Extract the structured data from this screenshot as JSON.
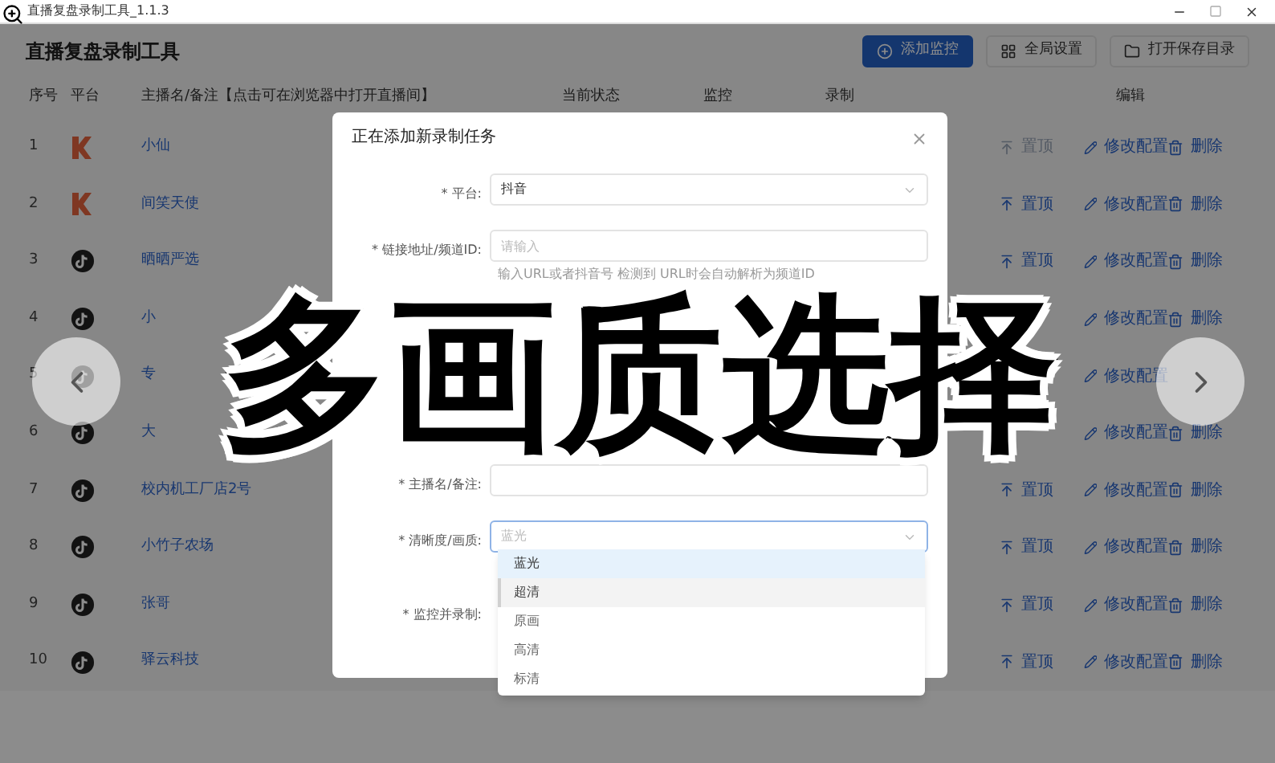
{
  "window": {
    "title": "直播复盘录制工具_1.1.3"
  },
  "header": {
    "title": "直播复盘录制工具",
    "buttons": [
      {
        "label": "添加监控",
        "kind": "primary"
      },
      {
        "label": "全局设置",
        "kind": "settings"
      },
      {
        "label": "打开保存目录",
        "kind": "folder"
      }
    ]
  },
  "table": {
    "columns": [
      "序号",
      "平台",
      "主播名/备注【点击可在浏览器中打开直播间】",
      "当前状态",
      "监控",
      "录制",
      "编辑"
    ],
    "rows": [
      {
        "index": "1",
        "kind": "kuaishou",
        "name": "小仙",
        "actions": [
          {
            "kind": "pin",
            "label": "置顶",
            "disabled": true
          },
          {
            "kind": "edit",
            "label": "修改配置",
            "disabled": false
          },
          {
            "kind": "delete",
            "label": "删除",
            "disabled": false
          }
        ]
      },
      {
        "index": "2",
        "kind": "kuaishou",
        "name": "间笑天使",
        "actions": [
          {
            "kind": "pin",
            "label": "置顶",
            "disabled": false
          },
          {
            "kind": "edit",
            "label": "修改配置",
            "disabled": false
          },
          {
            "kind": "delete",
            "label": "删除",
            "disabled": false
          }
        ]
      },
      {
        "index": "3",
        "kind": "douyin",
        "name": "晒晒严选",
        "actions": [
          {
            "kind": "pin",
            "label": "置顶",
            "disabled": false
          },
          {
            "kind": "edit",
            "label": "修改配置",
            "disabled": false
          },
          {
            "kind": "delete",
            "label": "删除",
            "disabled": false
          }
        ]
      },
      {
        "index": "4",
        "kind": "douyin",
        "name": "小",
        "actions": [
          {
            "kind": "edit",
            "label": "修改配置",
            "disabled": false
          },
          {
            "kind": "delete",
            "label": "删除",
            "disabled": false
          }
        ]
      },
      {
        "index": "5",
        "kind": "douyin",
        "name": "专",
        "actions": [
          {
            "kind": "edit",
            "label": "修改配置",
            "disabled": false
          }
        ]
      },
      {
        "index": "6",
        "kind": "douyin",
        "name": "大",
        "actions": [
          {
            "kind": "edit",
            "label": "修改配置",
            "disabled": false
          },
          {
            "kind": "delete",
            "label": "删除",
            "disabled": false
          }
        ]
      },
      {
        "index": "7",
        "kind": "douyin",
        "name": "校内机工厂店2号",
        "actions": [
          {
            "kind": "pin",
            "label": "置顶",
            "disabled": false
          },
          {
            "kind": "edit",
            "label": "修改配置",
            "disabled": false
          },
          {
            "kind": "delete",
            "label": "删除",
            "disabled": false
          }
        ]
      },
      {
        "index": "8",
        "kind": "douyin",
        "name": "小竹子农场",
        "actions": [
          {
            "kind": "pin",
            "label": "置顶",
            "disabled": false
          },
          {
            "kind": "edit",
            "label": "修改配置",
            "disabled": false
          },
          {
            "kind": "delete",
            "label": "删除",
            "disabled": false
          }
        ]
      },
      {
        "index": "9",
        "kind": "douyin",
        "name": "张哥",
        "actions": [
          {
            "kind": "pin",
            "label": "置顶",
            "disabled": false
          },
          {
            "kind": "edit",
            "label": "修改配置",
            "disabled": false
          },
          {
            "kind": "delete",
            "label": "删除",
            "disabled": false
          }
        ]
      },
      {
        "index": "10",
        "kind": "douyin",
        "name": "驿云科技",
        "actions": [
          {
            "kind": "pin",
            "label": "置顶",
            "disabled": false
          },
          {
            "kind": "edit",
            "label": "修改配置",
            "disabled": false
          },
          {
            "kind": "delete",
            "label": "删除",
            "disabled": false
          }
        ]
      }
    ]
  },
  "dialog": {
    "title": "正在添加新录制任务",
    "platform": {
      "label": "* 平台:",
      "value": "抖音"
    },
    "url": {
      "label": "* 链接地址/频道ID:",
      "placeholder": "请输入",
      "hint": "输入URL或者抖音号 检测到 URL时会自动解析为频道ID"
    },
    "name": {
      "label": "* 主播名/备注:"
    },
    "quality": {
      "label": "* 清晰度/画质:",
      "placeholder": "蓝光",
      "options": [
        {
          "label": "蓝光",
          "selected": true,
          "hovered": false
        },
        {
          "label": "超清",
          "selected": false,
          "hovered": true
        },
        {
          "label": "原画",
          "selected": false,
          "hovered": false
        },
        {
          "label": "高清",
          "selected": false,
          "hovered": false
        },
        {
          "label": "标清",
          "selected": false,
          "hovered": false
        }
      ]
    },
    "monitor": {
      "label": "* 监控并录制:"
    }
  },
  "caption": "多画质选择"
}
